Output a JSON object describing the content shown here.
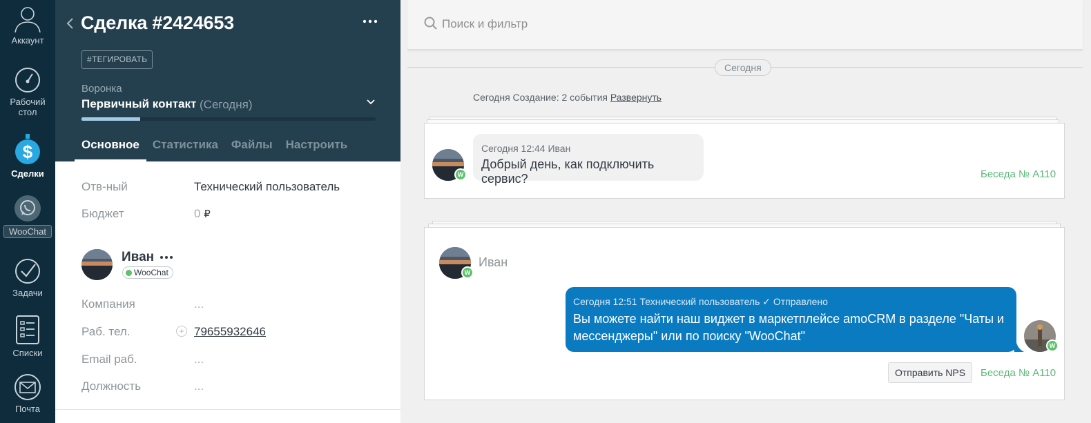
{
  "nav": {
    "items": [
      {
        "label": "Аккаунт",
        "icon": "user-icon"
      },
      {
        "label_line1": "Рабочий",
        "label_line2": "стол",
        "icon": "dashboard-icon"
      },
      {
        "label": "Сделки",
        "icon": "deals-icon"
      },
      {
        "label": "WooChat",
        "icon": "whatsapp-icon"
      },
      {
        "label": "Задачи",
        "icon": "tasks-icon"
      },
      {
        "label": "Списки",
        "icon": "lists-icon"
      },
      {
        "label": "Почта",
        "icon": "mail-icon"
      }
    ]
  },
  "deal": {
    "title": "Сделка #2424653",
    "tag_button": "#ТЕГИРОВАТЬ",
    "funnel_label": "Воронка",
    "stage": "Первичный контакт",
    "stage_date": "(Сегодня)",
    "progress_fraction": 0.2,
    "tabs": [
      "Основное",
      "Статистика",
      "Файлы",
      "Настроить"
    ],
    "fields": {
      "responsible_label": "Отв-ный",
      "responsible_value": "Технический пользователь",
      "budget_label": "Бюджет",
      "budget_value": "0",
      "budget_currency": "₽"
    },
    "contact": {
      "name": "Иван",
      "source_chip": "WooChat",
      "company_label": "Компания",
      "company_value": "...",
      "phone_label": "Раб. тел.",
      "phone_value": "79655932646",
      "email_label": "Email раб.",
      "email_value": "...",
      "position_label": "Должность",
      "position_value": "..."
    }
  },
  "feed": {
    "search_placeholder": "Поиск и фильтр",
    "day_separator": "Сегодня",
    "events_summary": "Сегодня Создание: 2 события",
    "expand_link": "Развернуть",
    "incoming": {
      "meta": "Сегодня 12:44 Иван",
      "text": "Добрый день, как подключить сервис?",
      "chat_link": "Беседа № A110"
    },
    "outgoing": {
      "sender_name": "Иван",
      "meta": "Сегодня 12:51 Технический пользователь ✓ Отправлено",
      "text": "Вы можете найти наш виджет в маркетплейсе amoCRM в разделе \"Чаты и мессенджеры\" или по поиску \"WooChat\"",
      "nps_button": "Отправить NPS",
      "chat_link": "Беседа № A110"
    }
  },
  "colors": {
    "nav_bg": "#0f2c3c",
    "header_bg": "#243f4d",
    "outgoing_bubble": "#0a7bc1",
    "chat_link": "#5cb87a",
    "woochat_badge": "#5ec16c"
  }
}
